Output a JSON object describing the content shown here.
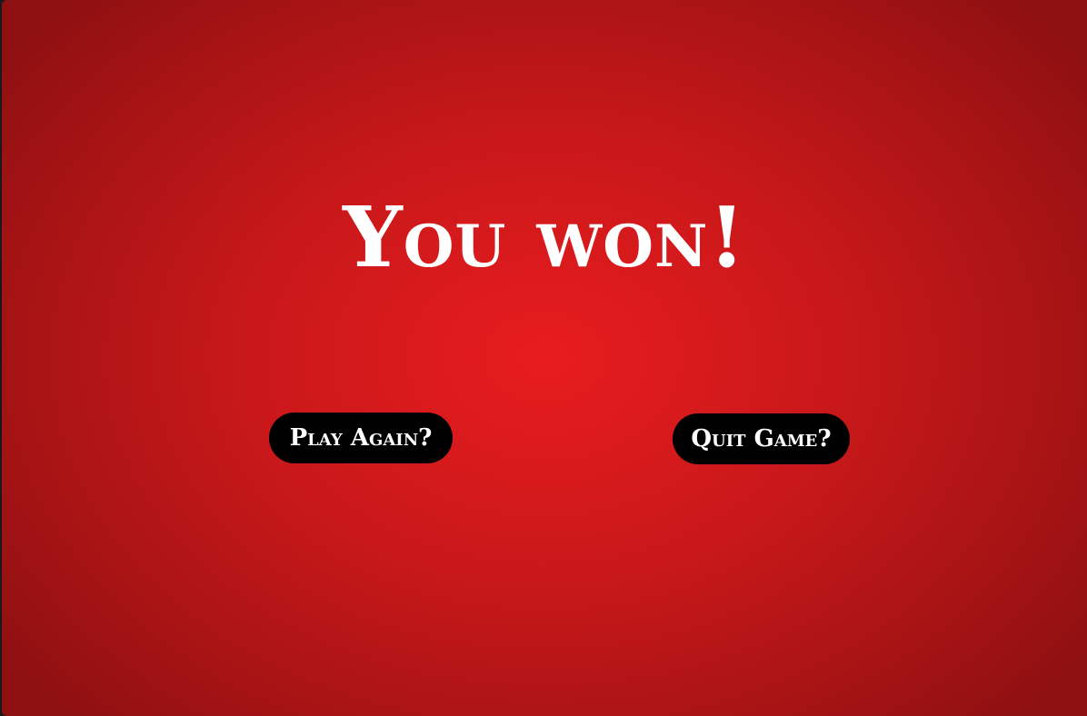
{
  "game": {
    "result_title": "You won!",
    "play_again_label": "Play Again?",
    "quit_label": "Quit Game?"
  },
  "colors": {
    "background_center": "#e81c1e",
    "background_edge": "#8f1011",
    "button_bg": "#000000",
    "text": "#ffffff"
  }
}
